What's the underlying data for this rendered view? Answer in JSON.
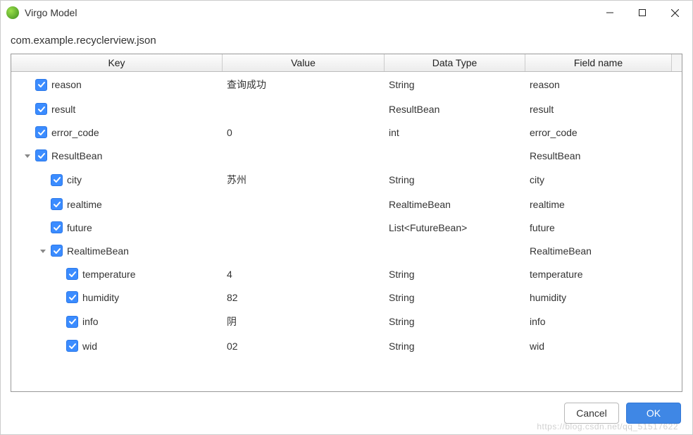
{
  "window": {
    "title": "Virgo Model"
  },
  "subtitle": "com.example.recyclerview.json",
  "columns": {
    "key": "Key",
    "value": "Value",
    "data_type": "Data Type",
    "field_name": "Field name"
  },
  "rows": [
    {
      "indent": 0,
      "expander": null,
      "checked": true,
      "key": "reason",
      "value": "查询成功",
      "type": "String",
      "field": "reason"
    },
    {
      "indent": 0,
      "expander": null,
      "checked": true,
      "key": "result",
      "value": "",
      "type": "ResultBean",
      "field": "result"
    },
    {
      "indent": 0,
      "expander": null,
      "checked": true,
      "key": "error_code",
      "value": "0",
      "type": "int",
      "field": "error_code"
    },
    {
      "indent": 0,
      "expander": "expanded",
      "checked": true,
      "key": "ResultBean",
      "value": "",
      "type": "",
      "field": "ResultBean"
    },
    {
      "indent": 1,
      "expander": null,
      "checked": true,
      "key": "city",
      "value": "苏州",
      "type": "String",
      "field": "city"
    },
    {
      "indent": 1,
      "expander": null,
      "checked": true,
      "key": "realtime",
      "value": "",
      "type": "RealtimeBean",
      "field": "realtime"
    },
    {
      "indent": 1,
      "expander": null,
      "checked": true,
      "key": "future",
      "value": "",
      "type": "List<FutureBean>",
      "field": "future"
    },
    {
      "indent": 1,
      "expander": "expanded",
      "checked": true,
      "key": "RealtimeBean",
      "value": "",
      "type": "",
      "field": "RealtimeBean"
    },
    {
      "indent": 2,
      "expander": null,
      "checked": true,
      "key": "temperature",
      "value": "4",
      "type": "String",
      "field": "temperature"
    },
    {
      "indent": 2,
      "expander": null,
      "checked": true,
      "key": "humidity",
      "value": "82",
      "type": "String",
      "field": "humidity"
    },
    {
      "indent": 2,
      "expander": null,
      "checked": true,
      "key": "info",
      "value": "阴",
      "type": "String",
      "field": "info"
    },
    {
      "indent": 2,
      "expander": null,
      "checked": true,
      "key": "wid",
      "value": "02",
      "type": "String",
      "field": "wid"
    }
  ],
  "buttons": {
    "cancel": "Cancel",
    "ok": "OK"
  },
  "watermark": "https://blog.csdn.net/qq_51517622"
}
